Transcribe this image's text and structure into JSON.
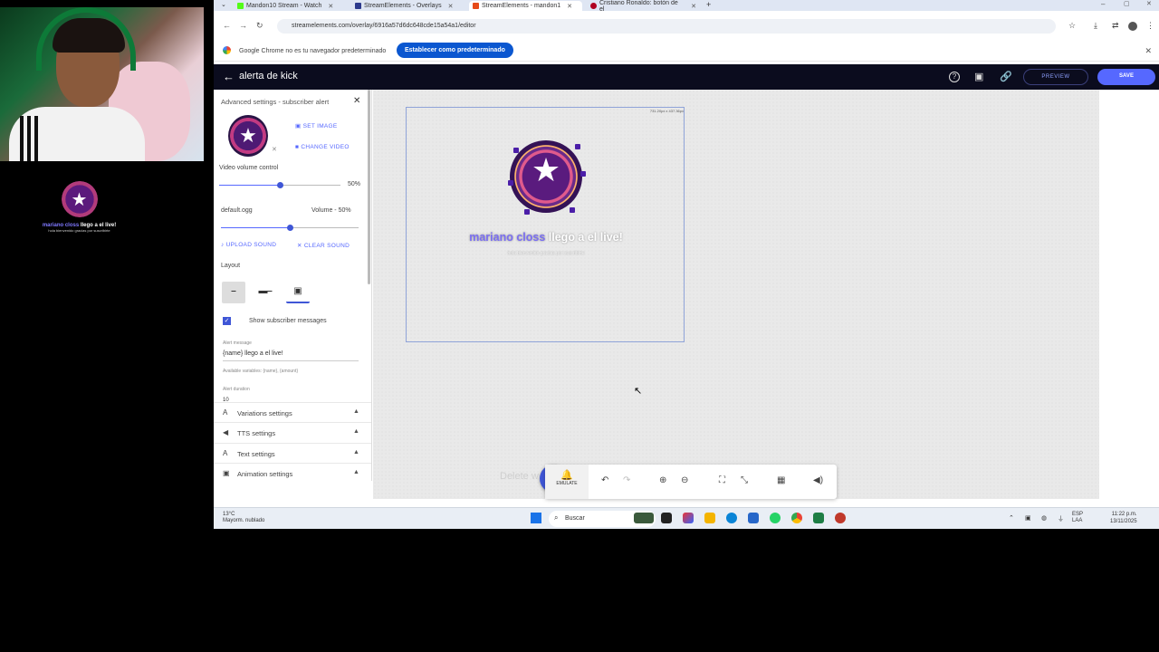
{
  "stream_overlay": {
    "alert_name": "mariano closs",
    "alert_text": " llego a el live!",
    "alert_sub": "hola bienvenido gracias por suscribirte"
  },
  "browser": {
    "tabs": [
      {
        "label": "Mandon10 Stream - Watch",
        "color": "#53fc18"
      },
      {
        "label": "StreamElements - Overlays",
        "color": "#2d3a8c"
      },
      {
        "label": "StreamElements - mandon1",
        "color": "#e64a19"
      },
      {
        "label": "Cristiano Ronaldo: botón de el",
        "color": "#b00020"
      }
    ],
    "url": "streamelements.com/overlay/6916a57d6dc648cde15a54a1/editor",
    "infobar_message": "Google Chrome no es tu navegador predeterminado",
    "infobar_button": "Establecer como predeterminado"
  },
  "se_header": {
    "title": "alerta de kick",
    "preview_label": "PREVIEW",
    "save_label": "SAVE"
  },
  "panel": {
    "title": "Advanced settings - subscriber alert",
    "set_image": "SET IMAGE",
    "change_video": "CHANGE VIDEO",
    "video_volume_label": "Video volume control",
    "video_volume_value": "50%",
    "video_volume_fraction": 0.5,
    "sound_file": "default.ogg",
    "sound_volume": "Volume - 50%",
    "sound_volume_fraction": 0.5,
    "upload_sound": "UPLOAD SOUND",
    "clear_sound": "CLEAR SOUND",
    "layout_label": "Layout",
    "show_messages_label": "Show subscriber messages",
    "show_messages_checked": true,
    "alert_message_label": "Alert message",
    "alert_message_value": "{name} llego a el live!",
    "available_variables": "Available variables: {name}, {amount}",
    "alert_duration_label": "Alert duration",
    "alert_duration_value": "10",
    "sections": [
      "Variations settings",
      "TTS settings",
      "Text settings",
      "Animation settings"
    ]
  },
  "canvas": {
    "widget_size": "731.20px x 437.36px",
    "delete_hint": "Delete w",
    "emulate_label": "EMULATE"
  },
  "taskbar": {
    "temp": "13°C",
    "weather": "Mayorm. nublado",
    "search_placeholder": "Buscar",
    "lang": "ESP",
    "lang2": "LAA",
    "time": "11:22 p.m.",
    "date": "13/11/2025"
  }
}
